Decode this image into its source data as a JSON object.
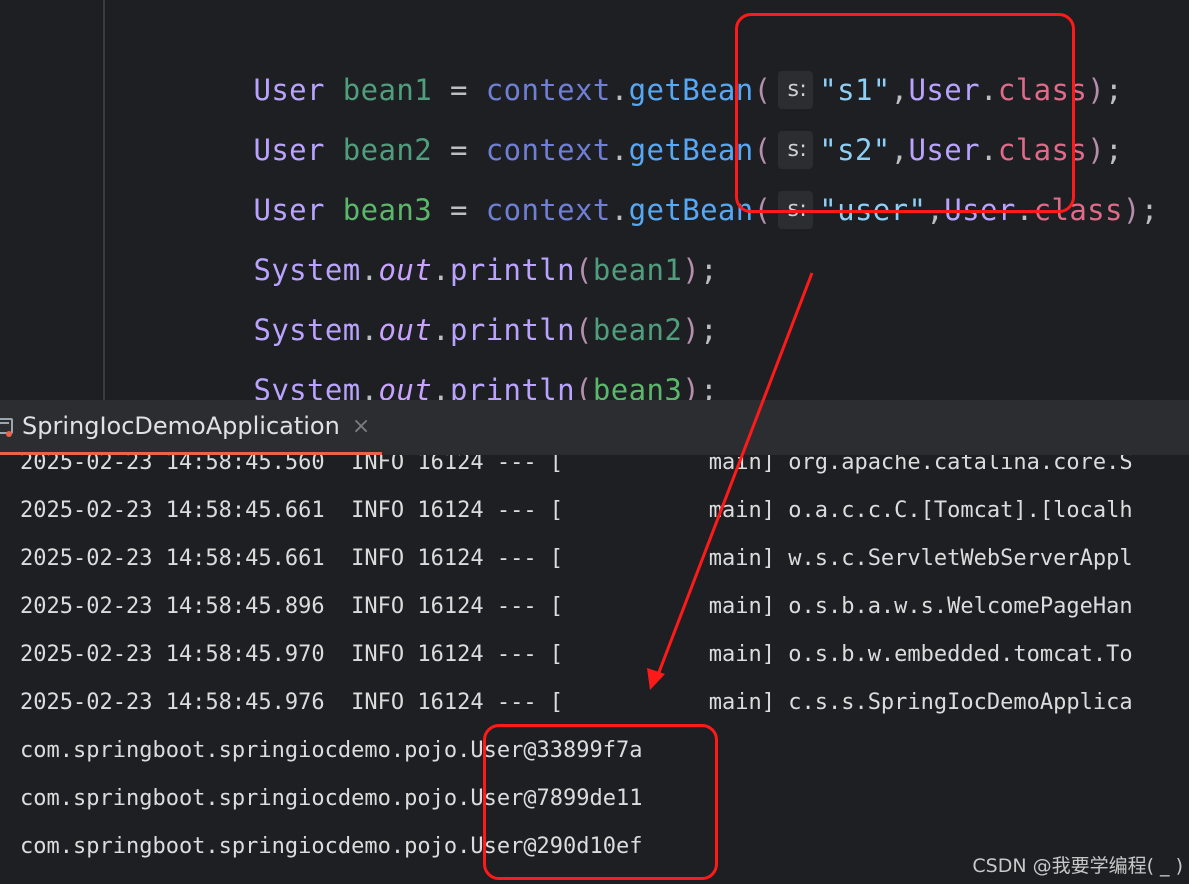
{
  "code": {
    "lines": [
      {
        "type": "User",
        "var": "bean1",
        "eq": "=",
        "obj": "context",
        "dot": ".",
        "method": "getBean",
        "open": "(",
        "hint": "s:",
        "arg": "\"s1\"",
        "comma": ",",
        "cls": "User",
        "dot2": ".",
        "kw": "class",
        "close": ")",
        "semi": ";"
      },
      {
        "type": "User",
        "var": "bean2",
        "eq": "=",
        "obj": "context",
        "dot": ".",
        "method": "getBean",
        "open": "(",
        "hint": "s:",
        "arg": "\"s2\"",
        "comma": ",",
        "cls": "User",
        "dot2": ".",
        "kw": "class",
        "close": ")",
        "semi": ";"
      },
      {
        "type": "User",
        "var": "bean3",
        "eq": "=",
        "obj": "context",
        "dot": ".",
        "method": "getBean",
        "open": "(",
        "hint": "s:",
        "arg": "\"user\"",
        "comma": ",",
        "cls": "User",
        "dot2": ".",
        "kw": "class",
        "close": ")",
        "semi": ";"
      }
    ],
    "prints": [
      {
        "sys": "System",
        "dot": ".",
        "out": "out",
        "dot2": ".",
        "fn": "println",
        "open": "(",
        "arg": "bean1",
        "close": ")",
        "semi": ";"
      },
      {
        "sys": "System",
        "dot": ".",
        "out": "out",
        "dot2": ".",
        "fn": "println",
        "open": "(",
        "arg": "bean2",
        "close": ")",
        "semi": ";"
      },
      {
        "sys": "System",
        "dot": ".",
        "out": "out",
        "dot2": ".",
        "fn": "println",
        "open": "(",
        "arg": "bean3",
        "close": ")",
        "semi": ";"
      }
    ]
  },
  "run_tab": {
    "label": "SpringIocDemoApplication",
    "close_glyph": "×",
    "icon": "run-console-icon"
  },
  "console": {
    "lines": [
      "2025-02-23 14:58:45.560  INFO 16124 --- [           main] org.apache.catalina.core.S",
      "2025-02-23 14:58:45.661  INFO 16124 --- [           main] o.a.c.c.C.[Tomcat].[localh",
      "2025-02-23 14:58:45.661  INFO 16124 --- [           main] w.s.c.ServletWebServerAppl",
      "2025-02-23 14:58:45.896  INFO 16124 --- [           main] o.s.b.a.w.s.WelcomePageHan",
      "2025-02-23 14:58:45.970  INFO 16124 --- [           main] o.s.b.w.embedded.tomcat.To",
      "2025-02-23 14:58:45.976  INFO 16124 --- [           main] c.s.s.SpringIocDemoApplica",
      "com.springboot.springiocdemo.pojo.User@33899f7a",
      "com.springboot.springiocdemo.pojo.User@7899de11",
      "com.springboot.springiocdemo.pojo.User@290d10ef"
    ]
  },
  "watermark": "CSDN @我要学编程( _ )",
  "colors": {
    "annotation": "#ff1a1a",
    "tab_accent": "#e8634a",
    "background": "#1e1f22"
  }
}
